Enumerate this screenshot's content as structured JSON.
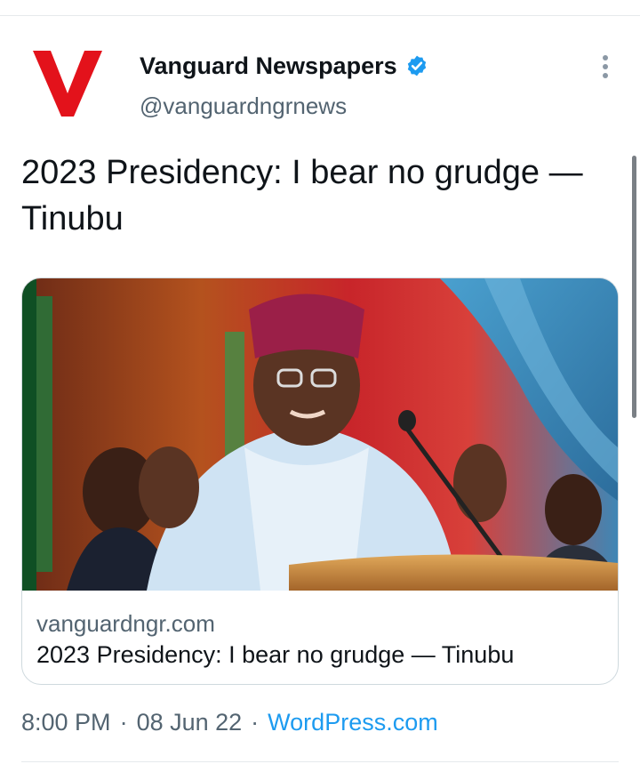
{
  "author": {
    "name": "Vanguard Newspapers",
    "handle": "@vanguardngrnews",
    "avatar_letter": "V",
    "brand_color": "#e3121b",
    "verified_color": "#1d9bf0"
  },
  "tweet": {
    "text": "2023 Presidency: I bear no grudge — Tinubu"
  },
  "card": {
    "domain": "vanguardngr.com",
    "title": "2023 Presidency: I bear no grudge — Tinubu"
  },
  "meta": {
    "time": "8:00 PM",
    "separator": "·",
    "date": "08 Jun 22",
    "source": "WordPress.com"
  },
  "icons": {
    "more": "more-vertical-icon",
    "verified": "verified-badge-icon"
  }
}
